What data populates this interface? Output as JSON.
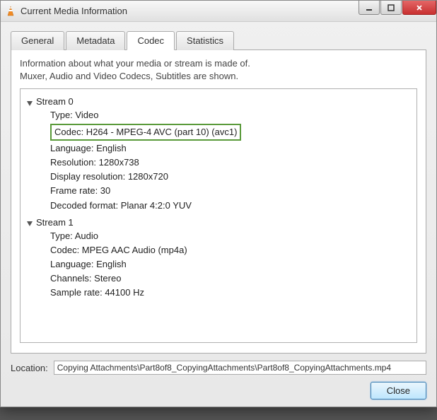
{
  "window": {
    "title": "Current Media Information"
  },
  "tabs": {
    "t0": "General",
    "t1": "Metadata",
    "t2": "Codec",
    "t3": "Statistics"
  },
  "info": {
    "line1": "Information about what your media or stream is made of.",
    "line2": "Muxer, Audio and Video Codecs, Subtitles are shown."
  },
  "streams": [
    {
      "name": "Stream 0",
      "props": [
        "Type: Video",
        "Codec: H264 - MPEG-4 AVC (part 10) (avc1)",
        "Language: English",
        "Resolution: 1280x738",
        "Display resolution: 1280x720",
        "Frame rate: 30",
        "Decoded format: Planar 4:2:0 YUV"
      ]
    },
    {
      "name": "Stream 1",
      "props": [
        "Type: Audio",
        "Codec: MPEG AAC Audio (mp4a)",
        "Language: English",
        "Channels: Stereo",
        "Sample rate: 44100 Hz"
      ]
    }
  ],
  "location": {
    "label": "Location:",
    "value": "Copying Attachments\\Part8of8_CopyingAttachments\\Part8of8_CopyingAttachments.mp4"
  },
  "buttons": {
    "close": "Close"
  }
}
